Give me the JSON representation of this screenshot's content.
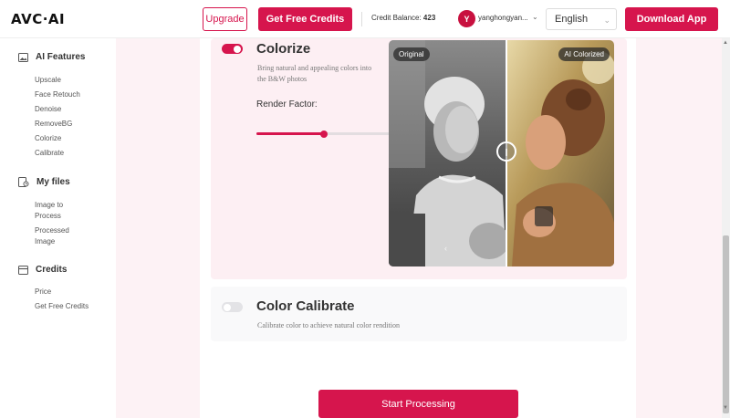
{
  "header": {
    "logo": "AVC·AI",
    "upgrade_label": "Upgrade",
    "free_credits_label": "Get Free Credits",
    "credit_prefix": "Credit Balance: ",
    "credit_value": "423",
    "avatar_initial": "Y",
    "username": "yanghongyan...",
    "language": "English",
    "download_label": "Download App"
  },
  "sidebar": {
    "ai_features": {
      "title": "AI Features",
      "items": [
        "Upscale",
        "Face Retouch",
        "Denoise",
        "RemoveBG",
        "Colorize",
        "Calibrate"
      ]
    },
    "my_files": {
      "title": "My files",
      "items": [
        "Image to\nProcess",
        "Processed\nImage"
      ]
    },
    "credits": {
      "title": "Credits",
      "items": [
        "Price",
        "Get Free Credits"
      ]
    }
  },
  "colorize": {
    "enabled": true,
    "title": "Colorize",
    "desc_line1": "Bring natural and appealing colors into",
    "desc_line2": "the B&W photos",
    "render_label": "Render Factor:",
    "render_factor": 0.49,
    "tag_original": "Original",
    "tag_colorized": "AI Colorized"
  },
  "calibrate": {
    "enabled": false,
    "title": "Color Calibrate",
    "desc": "Calibrate color to achieve natural color rendition"
  },
  "start_label": "Start Processing",
  "colors": {
    "accent": "#d6154d",
    "main_bg": "#fdf2f5",
    "card_bg": "#fdeff3"
  }
}
